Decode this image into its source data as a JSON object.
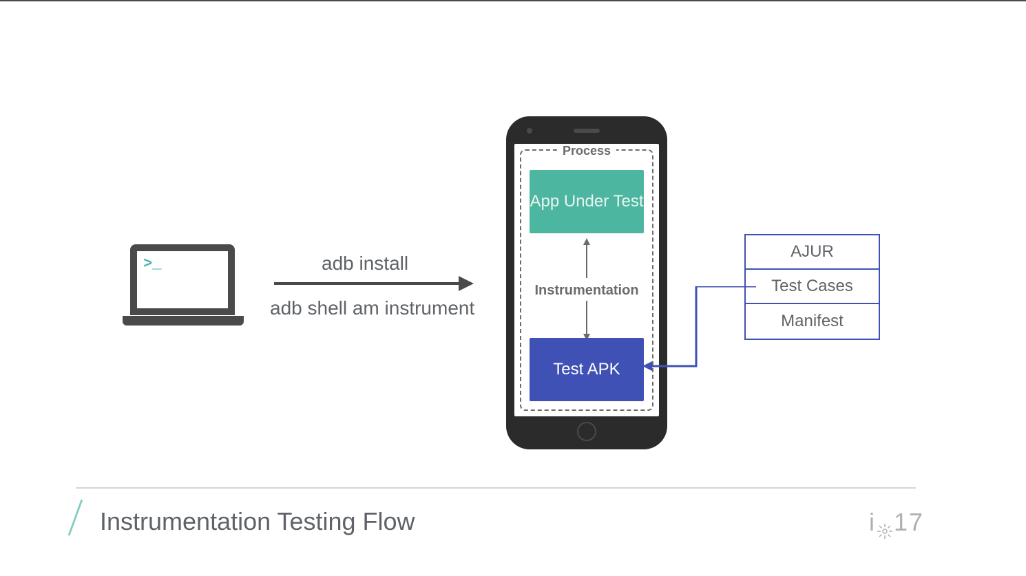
{
  "laptop": {
    "prompt": ">_"
  },
  "commands": {
    "top": "adb install",
    "bottom": "adb shell am instrument"
  },
  "process": {
    "label": "Process",
    "app": "App Under Test",
    "instrumentation": "Instrumentation",
    "test": "Test APK"
  },
  "apk_contents": {
    "rows": [
      "AJUR",
      "Test Cases",
      "Manifest"
    ]
  },
  "footer": {
    "title": "Instrumentation Testing Flow",
    "logo_left": "i",
    "logo_right": "17"
  }
}
